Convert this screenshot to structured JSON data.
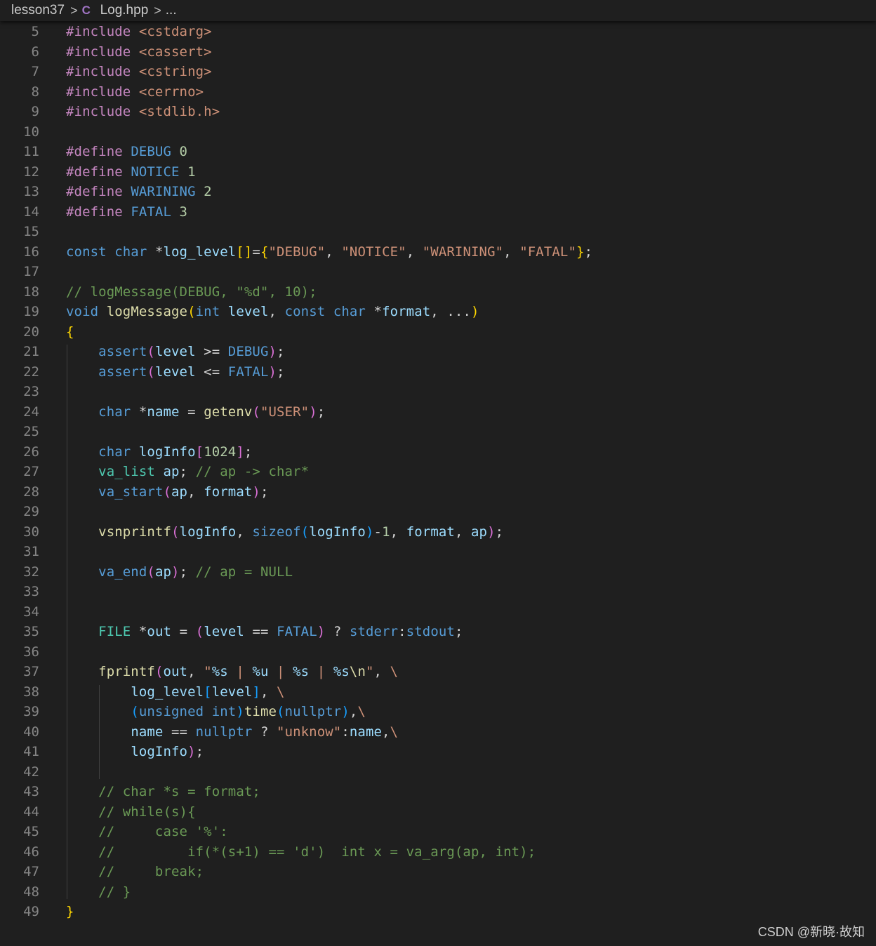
{
  "breadcrumb": {
    "folder": "lesson37",
    "file": "Log.hpp",
    "file_icon": "C",
    "more": "...",
    "separator": ">"
  },
  "colors": {
    "background": "#1f1f1f",
    "default": "#d4d4d4",
    "keyword": "#569cd6",
    "control": "#c586c0",
    "string": "#ce9178",
    "number": "#b5cea8",
    "comment": "#6a9955",
    "function": "#dcdcaa",
    "variable": "#9cdcfe",
    "type": "#4ec9b0",
    "bracket1": "#ffd700",
    "bracket2": "#da70d6",
    "bracket3": "#179fff",
    "macro": "#569cd6"
  },
  "editor": {
    "lines": [
      {
        "n": "5",
        "t": [
          [
            "#include ",
            "c"
          ],
          [
            "<cstdarg>",
            "s"
          ]
        ]
      },
      {
        "n": "6",
        "t": [
          [
            "#include ",
            "c"
          ],
          [
            "<cassert>",
            "s"
          ]
        ]
      },
      {
        "n": "7",
        "t": [
          [
            "#include ",
            "c"
          ],
          [
            "<cstring>",
            "s"
          ]
        ]
      },
      {
        "n": "8",
        "t": [
          [
            "#include ",
            "c"
          ],
          [
            "<cerrno>",
            "s"
          ]
        ]
      },
      {
        "n": "9",
        "t": [
          [
            "#include ",
            "c"
          ],
          [
            "<stdlib.h>",
            "s"
          ]
        ]
      },
      {
        "n": "10",
        "t": []
      },
      {
        "n": "11",
        "t": [
          [
            "#define ",
            "c"
          ],
          [
            "DEBUG ",
            "k"
          ],
          [
            "0",
            "n"
          ]
        ]
      },
      {
        "n": "12",
        "t": [
          [
            "#define ",
            "c"
          ],
          [
            "NOTICE ",
            "k"
          ],
          [
            "1",
            "n"
          ]
        ]
      },
      {
        "n": "13",
        "t": [
          [
            "#define ",
            "c"
          ],
          [
            "WARINING ",
            "k"
          ],
          [
            "2",
            "n"
          ]
        ]
      },
      {
        "n": "14",
        "t": [
          [
            "#define ",
            "c"
          ],
          [
            "FATAL ",
            "k"
          ],
          [
            "3",
            "n"
          ]
        ]
      },
      {
        "n": "15",
        "t": []
      },
      {
        "n": "16",
        "t": [
          [
            "const ",
            "k"
          ],
          [
            "char ",
            "k"
          ],
          [
            "*",
            "d"
          ],
          [
            "log_level",
            "v"
          ],
          [
            "[]",
            "b1"
          ],
          [
            "=",
            "d"
          ],
          [
            "{",
            "b1"
          ],
          [
            "\"DEBUG\"",
            "s"
          ],
          [
            ", ",
            "d"
          ],
          [
            "\"NOTICE\"",
            "s"
          ],
          [
            ", ",
            "d"
          ],
          [
            "\"WARINING\"",
            "s"
          ],
          [
            ", ",
            "d"
          ],
          [
            "\"FATAL\"",
            "s"
          ],
          [
            "}",
            "b1"
          ],
          [
            ";",
            "d"
          ]
        ]
      },
      {
        "n": "17",
        "t": []
      },
      {
        "n": "18",
        "t": [
          [
            "// logMessage(DEBUG, \"%d\", 10);",
            "cm"
          ]
        ]
      },
      {
        "n": "19",
        "t": [
          [
            "void ",
            "k"
          ],
          [
            "logMessage",
            "f"
          ],
          [
            "(",
            "b1"
          ],
          [
            "int ",
            "k"
          ],
          [
            "level",
            "v"
          ],
          [
            ", ",
            "d"
          ],
          [
            "const ",
            "k"
          ],
          [
            "char ",
            "k"
          ],
          [
            "*",
            "d"
          ],
          [
            "format",
            "v"
          ],
          [
            ", ...",
            "d"
          ],
          [
            ")",
            "b1"
          ]
        ]
      },
      {
        "n": "20",
        "t": [
          [
            "{",
            "b1"
          ]
        ]
      },
      {
        "n": "21",
        "t": [
          [
            "    ",
            "d"
          ],
          [
            "assert",
            "k"
          ],
          [
            "(",
            "b2"
          ],
          [
            "level",
            "v"
          ],
          [
            " >= ",
            "d"
          ],
          [
            "DEBUG",
            "k"
          ],
          [
            ")",
            "b2"
          ],
          [
            ";",
            "d"
          ]
        ]
      },
      {
        "n": "22",
        "t": [
          [
            "    ",
            "d"
          ],
          [
            "assert",
            "k"
          ],
          [
            "(",
            "b2"
          ],
          [
            "level",
            "v"
          ],
          [
            " <= ",
            "d"
          ],
          [
            "FATAL",
            "k"
          ],
          [
            ")",
            "b2"
          ],
          [
            ";",
            "d"
          ]
        ]
      },
      {
        "n": "23",
        "t": []
      },
      {
        "n": "24",
        "t": [
          [
            "    ",
            "d"
          ],
          [
            "char ",
            "k"
          ],
          [
            "*",
            "d"
          ],
          [
            "name",
            "v"
          ],
          [
            " = ",
            "d"
          ],
          [
            "getenv",
            "f"
          ],
          [
            "(",
            "b2"
          ],
          [
            "\"USER\"",
            "s"
          ],
          [
            ")",
            "b2"
          ],
          [
            ";",
            "d"
          ]
        ]
      },
      {
        "n": "25",
        "t": []
      },
      {
        "n": "26",
        "t": [
          [
            "    ",
            "d"
          ],
          [
            "char ",
            "k"
          ],
          [
            "logInfo",
            "v"
          ],
          [
            "[",
            "b2"
          ],
          [
            "1024",
            "n"
          ],
          [
            "]",
            "b2"
          ],
          [
            ";",
            "d"
          ]
        ]
      },
      {
        "n": "27",
        "t": [
          [
            "    ",
            "d"
          ],
          [
            "va_list ",
            "ty"
          ],
          [
            "ap",
            "v"
          ],
          [
            "; ",
            "d"
          ],
          [
            "// ap -> char*",
            "cm"
          ]
        ]
      },
      {
        "n": "28",
        "t": [
          [
            "    ",
            "d"
          ],
          [
            "va_start",
            "k"
          ],
          [
            "(",
            "b2"
          ],
          [
            "ap",
            "v"
          ],
          [
            ", ",
            "d"
          ],
          [
            "format",
            "v"
          ],
          [
            ")",
            "b2"
          ],
          [
            ";",
            "d"
          ]
        ]
      },
      {
        "n": "29",
        "t": []
      },
      {
        "n": "30",
        "t": [
          [
            "    ",
            "d"
          ],
          [
            "vsnprintf",
            "f"
          ],
          [
            "(",
            "b2"
          ],
          [
            "logInfo",
            "v"
          ],
          [
            ", ",
            "d"
          ],
          [
            "sizeof",
            "k"
          ],
          [
            "(",
            "b3"
          ],
          [
            "logInfo",
            "v"
          ],
          [
            ")",
            "b3"
          ],
          [
            "-",
            "d"
          ],
          [
            "1",
            "n"
          ],
          [
            ", ",
            "d"
          ],
          [
            "format",
            "v"
          ],
          [
            ", ",
            "d"
          ],
          [
            "ap",
            "v"
          ],
          [
            ")",
            "b2"
          ],
          [
            ";",
            "d"
          ]
        ]
      },
      {
        "n": "31",
        "t": []
      },
      {
        "n": "32",
        "t": [
          [
            "    ",
            "d"
          ],
          [
            "va_end",
            "k"
          ],
          [
            "(",
            "b2"
          ],
          [
            "ap",
            "v"
          ],
          [
            ")",
            "b2"
          ],
          [
            "; ",
            "d"
          ],
          [
            "// ap = NULL",
            "cm"
          ]
        ]
      },
      {
        "n": "33",
        "t": []
      },
      {
        "n": "34",
        "t": []
      },
      {
        "n": "35",
        "t": [
          [
            "    ",
            "d"
          ],
          [
            "FILE ",
            "ty"
          ],
          [
            "*",
            "d"
          ],
          [
            "out",
            "v"
          ],
          [
            " = ",
            "d"
          ],
          [
            "(",
            "b2"
          ],
          [
            "level",
            "v"
          ],
          [
            " == ",
            "d"
          ],
          [
            "FATAL",
            "k"
          ],
          [
            ")",
            "b2"
          ],
          [
            " ? ",
            "d"
          ],
          [
            "stderr",
            "k"
          ],
          [
            ":",
            "d"
          ],
          [
            "stdout",
            "k"
          ],
          [
            ";",
            "d"
          ]
        ]
      },
      {
        "n": "36",
        "t": []
      },
      {
        "n": "37",
        "t": [
          [
            "    ",
            "d"
          ],
          [
            "fprintf",
            "f"
          ],
          [
            "(",
            "b2"
          ],
          [
            "out",
            "v"
          ],
          [
            ", ",
            "d"
          ],
          [
            "\"",
            "s"
          ],
          [
            "%s",
            "v"
          ],
          [
            " | ",
            "s"
          ],
          [
            "%u",
            "v"
          ],
          [
            " | ",
            "s"
          ],
          [
            "%s",
            "v"
          ],
          [
            " | ",
            "s"
          ],
          [
            "%s",
            "v"
          ],
          [
            "\\n",
            "f"
          ],
          [
            "\"",
            "s"
          ],
          [
            ", ",
            "d"
          ],
          [
            "\\",
            "s"
          ]
        ]
      },
      {
        "n": "38",
        "t": [
          [
            "        ",
            "d"
          ],
          [
            "log_level",
            "v"
          ],
          [
            "[",
            "b3"
          ],
          [
            "level",
            "v"
          ],
          [
            "]",
            "b3"
          ],
          [
            ", ",
            "d"
          ],
          [
            "\\",
            "s"
          ]
        ]
      },
      {
        "n": "39",
        "t": [
          [
            "        ",
            "d"
          ],
          [
            "(",
            "b3"
          ],
          [
            "unsigned ",
            "k"
          ],
          [
            "int",
            "k"
          ],
          [
            ")",
            "b3"
          ],
          [
            "time",
            "f"
          ],
          [
            "(",
            "b3"
          ],
          [
            "nullptr",
            "k"
          ],
          [
            ")",
            "b3"
          ],
          [
            ",",
            "d"
          ],
          [
            "\\",
            "s"
          ]
        ]
      },
      {
        "n": "40",
        "t": [
          [
            "        ",
            "d"
          ],
          [
            "name",
            "v"
          ],
          [
            " == ",
            "d"
          ],
          [
            "nullptr",
            "k"
          ],
          [
            " ? ",
            "d"
          ],
          [
            "\"unknow\"",
            "s"
          ],
          [
            ":",
            "d"
          ],
          [
            "name",
            "v"
          ],
          [
            ",",
            "d"
          ],
          [
            "\\",
            "s"
          ]
        ]
      },
      {
        "n": "41",
        "t": [
          [
            "        ",
            "d"
          ],
          [
            "logInfo",
            "v"
          ],
          [
            ")",
            "b2"
          ],
          [
            ";",
            "d"
          ]
        ]
      },
      {
        "n": "42",
        "t": []
      },
      {
        "n": "43",
        "t": [
          [
            "    ",
            "d"
          ],
          [
            "// char *s = format;",
            "cm"
          ]
        ]
      },
      {
        "n": "44",
        "t": [
          [
            "    ",
            "d"
          ],
          [
            "// while(s){",
            "cm"
          ]
        ]
      },
      {
        "n": "45",
        "t": [
          [
            "    ",
            "d"
          ],
          [
            "//     case '%':",
            "cm"
          ]
        ]
      },
      {
        "n": "46",
        "t": [
          [
            "    ",
            "d"
          ],
          [
            "//         if(*(s+1) == 'd')  int x = va_arg(ap, int);",
            "cm"
          ]
        ]
      },
      {
        "n": "47",
        "t": [
          [
            "    ",
            "d"
          ],
          [
            "//     break;",
            "cm"
          ]
        ]
      },
      {
        "n": "48",
        "t": [
          [
            "    ",
            "d"
          ],
          [
            "// }",
            "cm"
          ]
        ]
      },
      {
        "n": "49",
        "t": [
          [
            "}",
            "b1"
          ]
        ]
      }
    ]
  },
  "watermark": "CSDN @新晓·故知"
}
